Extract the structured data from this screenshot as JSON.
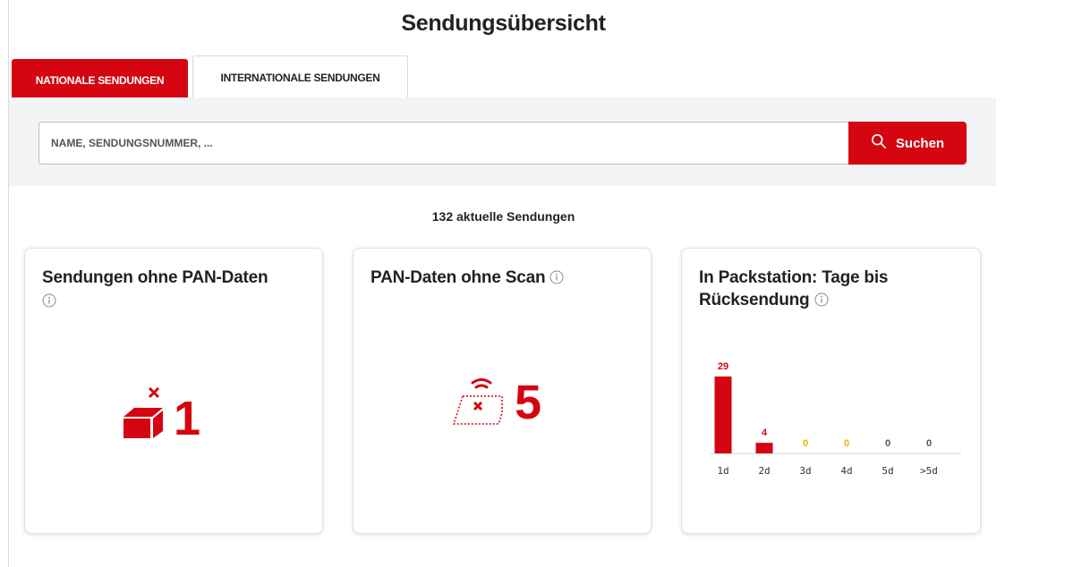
{
  "page": {
    "title": "Sendungsübersicht"
  },
  "tabs": [
    {
      "label": "NATIONALE SENDUNGEN",
      "active": true
    },
    {
      "label": "INTERNATIONALE SENDUNGEN",
      "active": false
    }
  ],
  "search": {
    "placeholder": "NAME, SENDUNGSNUMMER, ...",
    "value": "",
    "button_label": "Suchen",
    "button_icon": "search-icon"
  },
  "summary": {
    "count_text": "132 aktuelle Sendungen"
  },
  "cards": [
    {
      "title": "Sendungen ohne PAN-Daten",
      "icon": "parcel-x-icon",
      "value": "1"
    },
    {
      "title": "PAN-Daten ohne Scan",
      "icon": "scan-x-icon",
      "value": "5"
    },
    {
      "title_line1": "In Packstation: Tage bis",
      "title_line2": "Rücksendung"
    }
  ],
  "colors": {
    "accent": "#d40511",
    "zero_warning": "#f0b400",
    "zero_neutral": "#555555"
  },
  "chart_data": {
    "type": "bar",
    "categories": [
      "1d",
      "2d",
      "3d",
      "4d",
      "5d",
      ">5d"
    ],
    "values": [
      29,
      4,
      0,
      0,
      0,
      0
    ],
    "value_labels": [
      "29",
      "4",
      "0",
      "0",
      "0",
      "0"
    ],
    "label_colors": [
      "#d40511",
      "#d40511",
      "#f0b400",
      "#f0b400",
      "#555555",
      "#555555"
    ],
    "ylim": [
      0,
      29
    ]
  }
}
